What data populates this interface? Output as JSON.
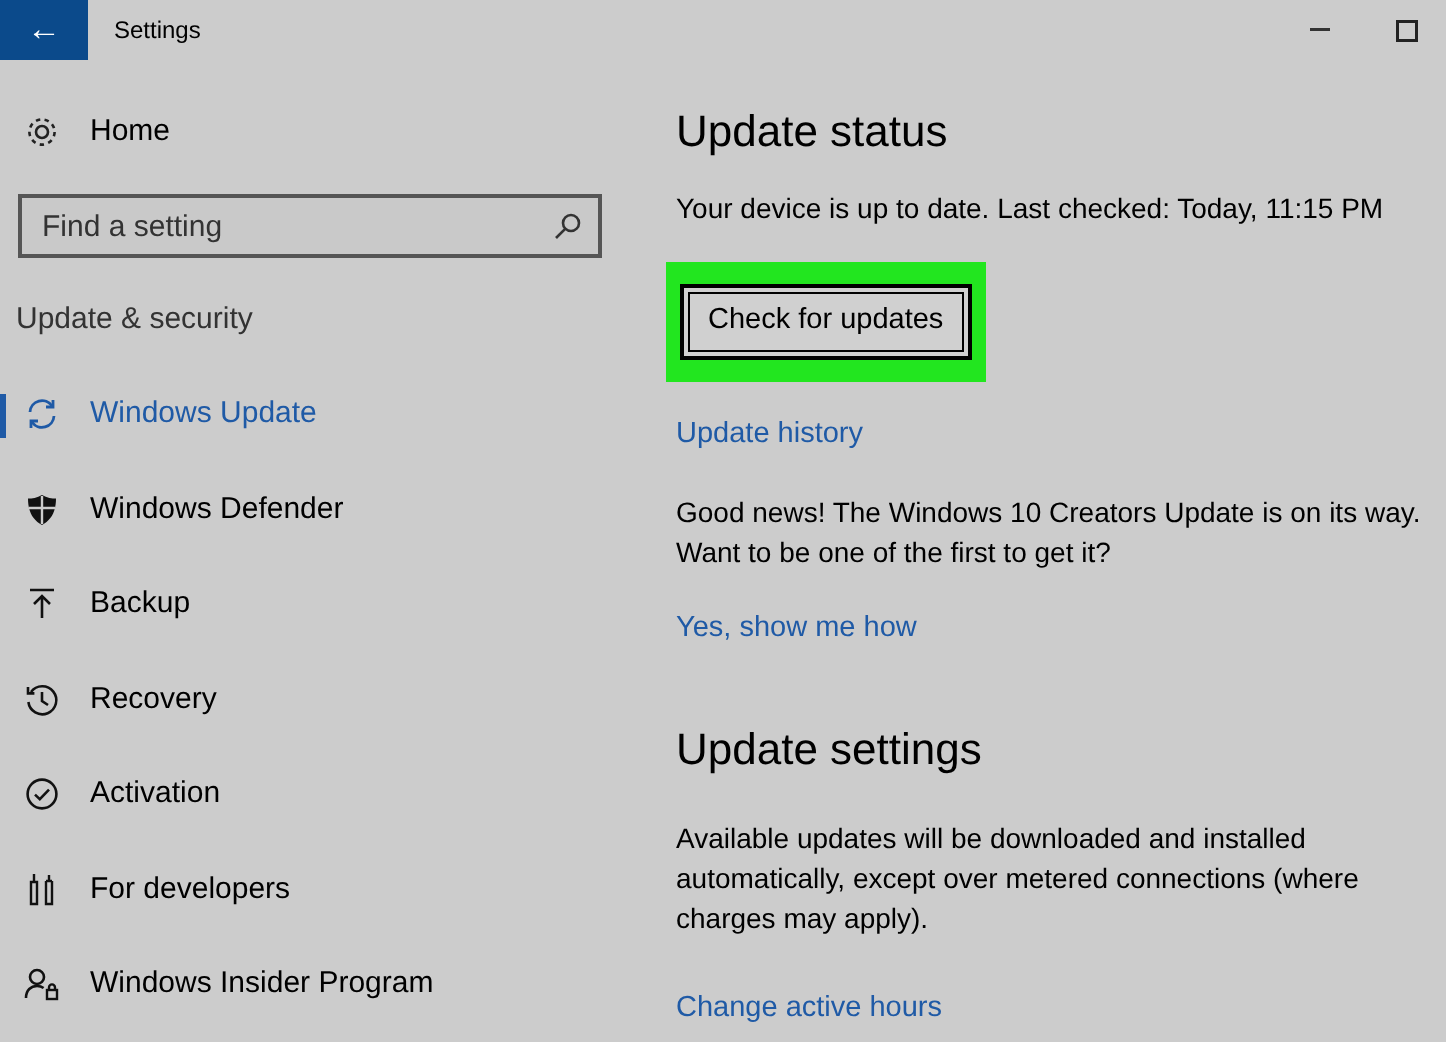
{
  "window": {
    "title": "Settings",
    "back_button": "←"
  },
  "sidebar": {
    "home": "Home",
    "search": {
      "placeholder": "Find a setting"
    },
    "section": "Update & security",
    "items": [
      {
        "label": "Windows Update",
        "selected": true
      },
      {
        "label": "Windows Defender",
        "selected": false
      },
      {
        "label": "Backup",
        "selected": false
      },
      {
        "label": "Recovery",
        "selected": false
      },
      {
        "label": "Activation",
        "selected": false
      },
      {
        "label": "For developers",
        "selected": false
      },
      {
        "label": "Windows Insider Program",
        "selected": false
      }
    ]
  },
  "update_status": {
    "heading": "Update status",
    "status": "Your device is up to date. Last checked: Today, 11:15 PM",
    "button": {
      "label": "Check for updates",
      "highlighted": true
    },
    "history_link": "Update history",
    "news": "Good news! The Windows 10 Creators Update is on its way. Want to be one of the first to get it?",
    "news_link": "Yes, show me how"
  },
  "update_settings": {
    "heading": "Update settings",
    "description": "Available updates will be downloaded and installed automatically, except over metered connections (where charges may apply).",
    "link": "Change active hours"
  }
}
